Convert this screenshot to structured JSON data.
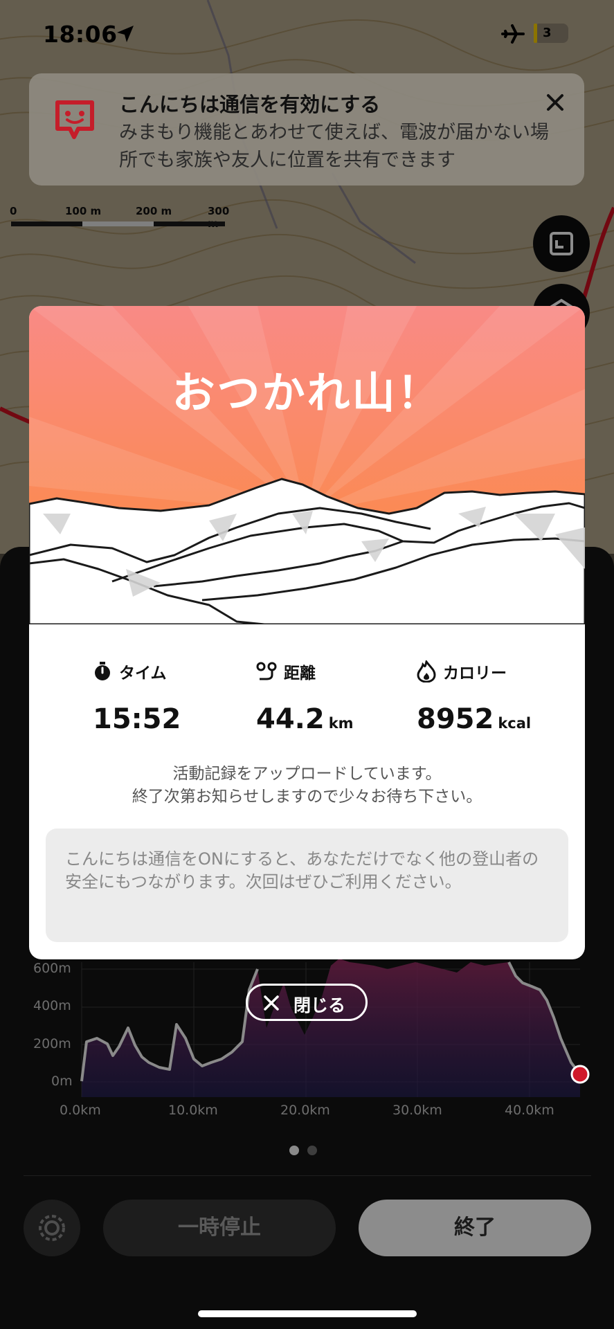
{
  "status_bar": {
    "time": "18:06",
    "battery": "3"
  },
  "banner": {
    "title": "こんにちは通信を有効にする",
    "body": "みまもり機能とあわせて使えば、電波が届かない場所でも家族や友人に位置を共有できます",
    "icons": [
      "app-icon",
      "close-icon"
    ]
  },
  "scale_bar": {
    "labels": [
      "0",
      "100 m",
      "200 m",
      "300 m"
    ]
  },
  "card": {
    "title": "おつかれ山！",
    "stats": [
      {
        "label": "タイム",
        "value": "15:52",
        "unit": "",
        "icon": "stopwatch-icon"
      },
      {
        "label": "距離",
        "value": "44.2",
        "unit": "km",
        "icon": "route-icon"
      },
      {
        "label": "カロリー",
        "value": "8952",
        "unit": "kcal",
        "icon": "flame-icon"
      }
    ],
    "message_line1": "活動記録をアップロードしています。",
    "message_line2": "終了次第お知らせしますので少々お待ち下さい。",
    "note": "こんにちは通信をONにすると、あなただけでなく他の登山者の安全にもつながります。次回はぜひご利用ください。",
    "close_label": "閉じる"
  },
  "elevation_chart": {
    "y_labels": [
      "600m",
      "400m",
      "200m",
      "0m"
    ],
    "x_labels": [
      "0.0km",
      "10.0km",
      "20.0km",
      "30.0km",
      "40.0km"
    ],
    "line_color": "#8a8a8a",
    "marker_color": "#d0182a"
  },
  "pager": {
    "pages": 2,
    "active": 0
  },
  "controls": {
    "pause_label": "一時停止",
    "end_label": "終了"
  },
  "colors": {
    "hero_top": "#f98a86",
    "hero_bottom": "#fc8a3a",
    "banner_icon": "#c51d2a"
  }
}
